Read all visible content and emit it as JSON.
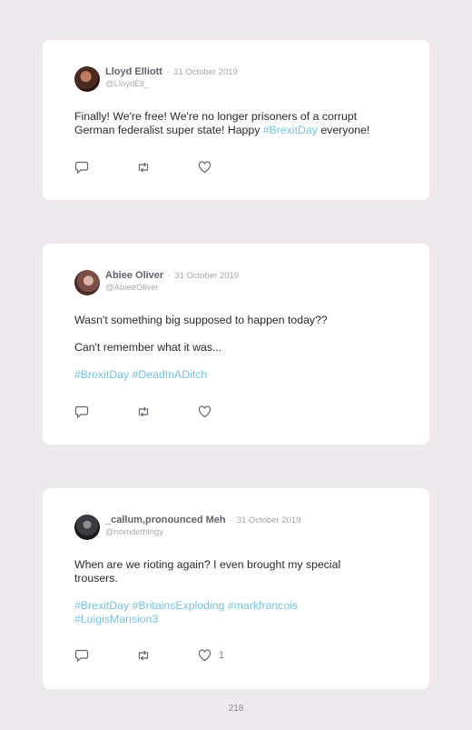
{
  "tweets": [
    {
      "name": "Lloyd Elliott",
      "separator": "·",
      "date": "31 October 2019",
      "handle": "@LloydEll_",
      "text_before": "Finally! We're free! We're no longer prisoners of a corrupt German federalist super state! Happy ",
      "hashtag": "#BrexitDay",
      "text_after": " everyone!",
      "avatar_color": "#3a1f1a",
      "icons": [
        "reply-icon",
        "retweet-icon",
        "like-icon"
      ]
    },
    {
      "name": "Abiee Oliver",
      "separator": "·",
      "date": "31 October 2019",
      "handle": "@AbieeOliver",
      "line1": "Wasn't something big supposed to happen today??",
      "line2": "Can't remember what it was...",
      "hashtags": "#BrexitDay #DeadInADitch",
      "avatar_color": "#8a5a55",
      "icons": [
        "reply-icon",
        "retweet-icon",
        "like-icon"
      ]
    },
    {
      "name": "_callum,pronounced Meh",
      "separator": "·",
      "date": "31 October 2019",
      "handle": "@nomdethingy",
      "line1": "When are we rioting again? I even brought my special trousers.",
      "hashtags_line1": "#BrexitDay #BritainsExploding #markfrancois",
      "hashtags_line2": "#LuigisMansion3",
      "like_count": "1",
      "avatar_color": "#2a2a2e",
      "icons": [
        "reply-icon",
        "retweet-icon",
        "like-icon"
      ]
    }
  ],
  "page_number": "218"
}
